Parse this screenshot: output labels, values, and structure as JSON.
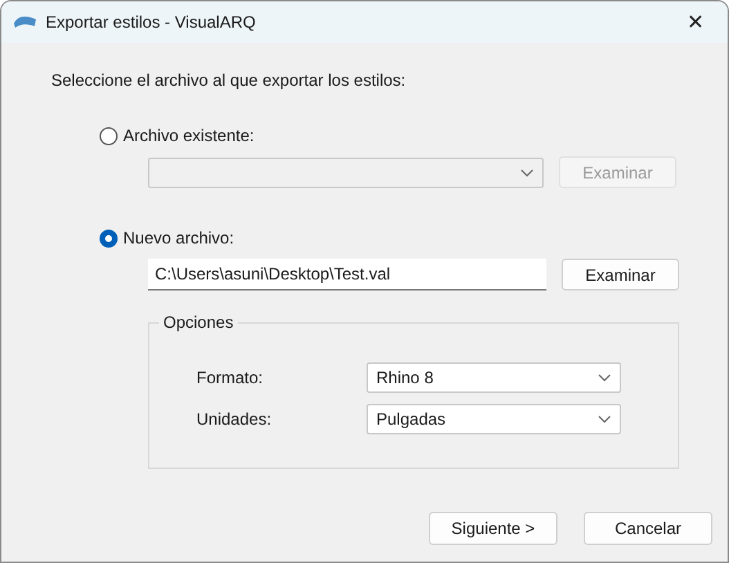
{
  "window": {
    "title": "Exportar estilos - VisualARQ",
    "close": "✕"
  },
  "instruction": "Seleccione el archivo al que exportar los estilos:",
  "sources": [
    {
      "kind": "combo",
      "label": "Archivo existente:",
      "selected": false,
      "disabled": true,
      "button": "Examinar"
    },
    {
      "kind": "text",
      "label": "Nuevo archivo:",
      "selected": true,
      "disabled": false,
      "value": "C:\\Users\\asuni\\Desktop\\Test.val",
      "button": "Examinar"
    }
  ],
  "options": {
    "legend": "Opciones",
    "fields": [
      {
        "label": "Formato:",
        "value": "Rhino 8"
      },
      {
        "label": "Unidades:",
        "value": "Pulgadas"
      }
    ]
  },
  "buttons": [
    "Siguiente >",
    "Cancelar"
  ]
}
